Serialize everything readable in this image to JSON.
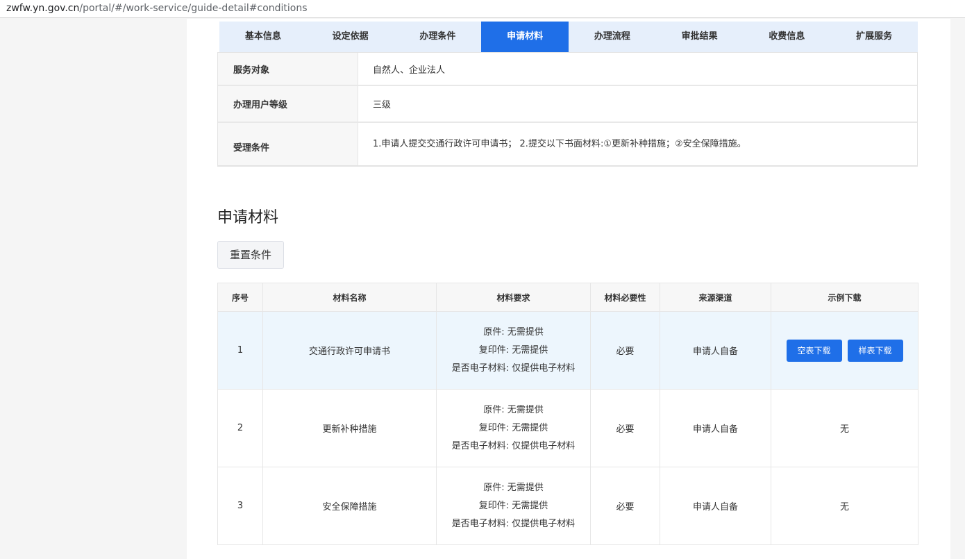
{
  "browser": {
    "url_host": "zwfw.yn.gov.cn",
    "url_path": "/portal/#/work-service/guide-detail#conditions"
  },
  "tabs": [
    {
      "label": "基本信息",
      "active": false
    },
    {
      "label": "设定依据",
      "active": false
    },
    {
      "label": "办理条件",
      "active": false
    },
    {
      "label": "申请材料",
      "active": true
    },
    {
      "label": "办理流程",
      "active": false
    },
    {
      "label": "审批结果",
      "active": false
    },
    {
      "label": "收费信息",
      "active": false
    },
    {
      "label": "扩展服务",
      "active": false
    }
  ],
  "conditions": [
    {
      "label": "服务对象",
      "value": "自然人、企业法人"
    },
    {
      "label": "办理用户等级",
      "value": "三级"
    },
    {
      "label": "受理条件",
      "value": "1.申请人提交交通行政许可申请书； 2.提交以下书面材料:①更新补种措施；②安全保障措施。"
    }
  ],
  "materials_section": {
    "title": "申请材料",
    "reset_label": "重置条件"
  },
  "table": {
    "headers": [
      "序号",
      "材料名称",
      "材料要求",
      "材料必要性",
      "来源渠道",
      "示例下载"
    ],
    "rows": [
      {
        "index": "1",
        "name": "交通行政许可申请书",
        "req_original": "原件: 无需提供",
        "req_copy": "复印件: 无需提供",
        "req_electronic": "是否电子材料: 仅提供电子材料",
        "necessity": "必要",
        "source": "申请人自备",
        "download_blank": "空表下载",
        "download_sample": "样表下载"
      },
      {
        "index": "2",
        "name": "更新补种措施",
        "req_original": "原件: 无需提供",
        "req_copy": "复印件: 无需提供",
        "req_electronic": "是否电子材料: 仅提供电子材料",
        "necessity": "必要",
        "source": "申请人自备",
        "download": "无"
      },
      {
        "index": "3",
        "name": "安全保障措施",
        "req_original": "原件: 无需提供",
        "req_copy": "复印件: 无需提供",
        "req_electronic": "是否电子材料: 仅提供电子材料",
        "necessity": "必要",
        "source": "申请人自备",
        "download": "无"
      }
    ]
  },
  "colors": {
    "primary": "#1f6fe8",
    "tab_bar_bg": "#e6effb",
    "highlight_row": "#edf6fd"
  }
}
